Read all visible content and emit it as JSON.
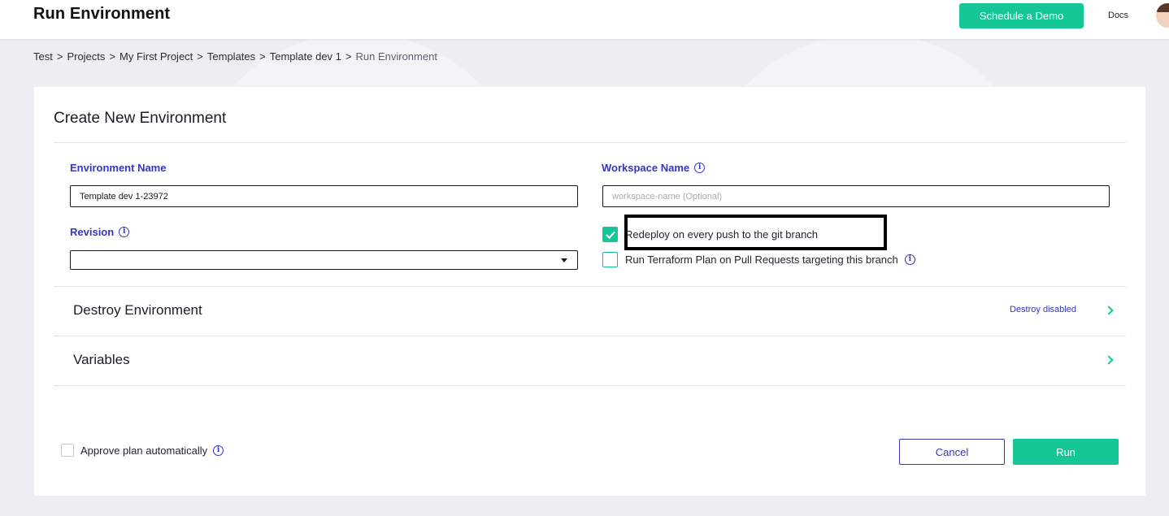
{
  "header": {
    "title": "Run Environment",
    "schedule_demo_label": "Schedule a Demo",
    "docs_label": "Docs",
    "avatar_icon": "user-avatar"
  },
  "breadcrumb": {
    "items": [
      "Test",
      "Projects",
      "My First Project",
      "Templates",
      "Template dev 1"
    ],
    "separator": ">",
    "current": "Run Environment"
  },
  "form": {
    "title": "Create New Environment",
    "environment_name": {
      "label": "Environment Name",
      "value": "Template dev 1-23972"
    },
    "workspace_name": {
      "label": "Workspace Name",
      "value": "",
      "placeholder": "workspace-name (Optional)"
    },
    "revision": {
      "label": "Revision",
      "value": ""
    },
    "redeploy_on_push": {
      "label": "Redeploy on every push to the git branch",
      "checked": true
    },
    "terraform_plan_on_pr": {
      "label": "Run Terraform Plan on Pull Requests targeting this branch",
      "checked": false
    }
  },
  "sections": {
    "destroy": {
      "title": "Destroy Environment",
      "status": "Destroy disabled"
    },
    "variables": {
      "title": "Variables"
    }
  },
  "footer": {
    "approve_plan": {
      "label": "Approve plan automatically",
      "checked": false
    },
    "cancel_label": "Cancel",
    "run_label": "Run"
  },
  "colors": {
    "accent_green": "#14c795",
    "label_blue": "#3536b9",
    "background": "#eceef2"
  }
}
